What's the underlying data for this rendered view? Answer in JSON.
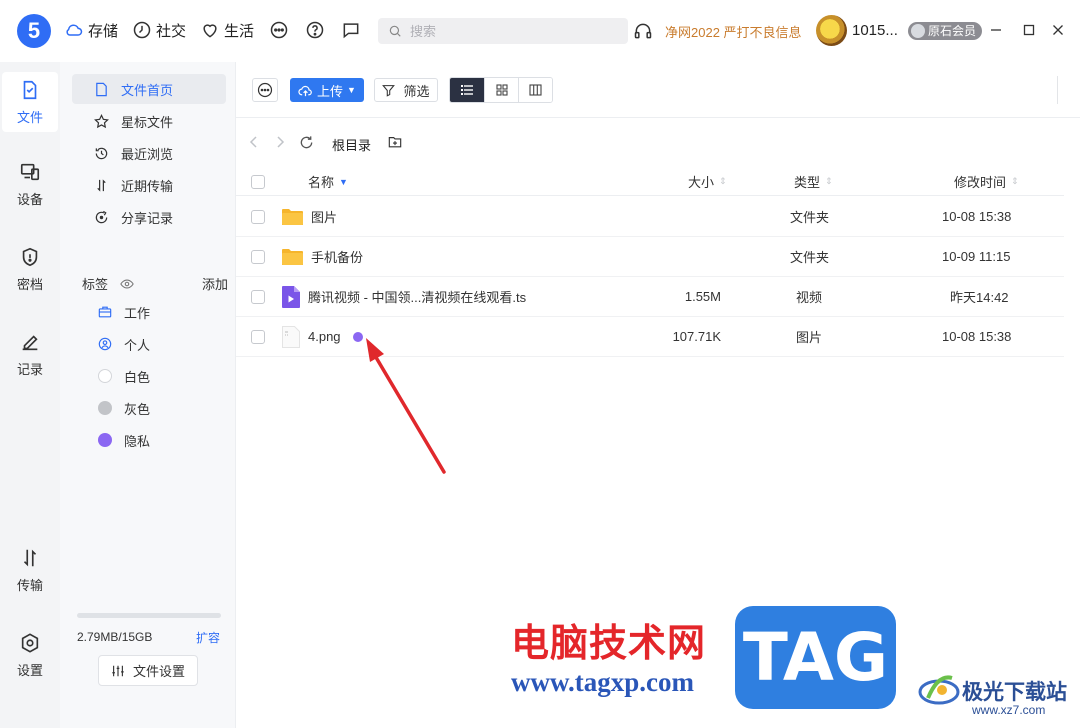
{
  "app": {
    "logo_text": "5",
    "nav": [
      {
        "label": "存储",
        "icon": "cloud-icon"
      },
      {
        "label": "社交",
        "icon": "clock-icon"
      },
      {
        "label": "生活",
        "icon": "heart-icon"
      }
    ],
    "search_placeholder": "搜索",
    "promo_text": "净网2022 严打不良信息",
    "username": "1015...",
    "vip_label": "原石会员"
  },
  "rail": [
    {
      "label": "文件",
      "icon": "file-icon",
      "active": true
    },
    {
      "label": "设备",
      "icon": "device-icon"
    },
    {
      "label": "密档",
      "icon": "shield-icon"
    },
    {
      "label": "记录",
      "icon": "pen-icon"
    },
    {
      "label": "传输",
      "icon": "transfer-icon"
    },
    {
      "label": "设置",
      "icon": "settings-icon"
    }
  ],
  "sidebar": {
    "items": [
      {
        "label": "文件首页",
        "icon": "file-home-icon",
        "active": true
      },
      {
        "label": "星标文件",
        "icon": "star-icon"
      },
      {
        "label": "最近浏览",
        "icon": "history-icon"
      },
      {
        "label": "近期传输",
        "icon": "transfer-icon"
      },
      {
        "label": "分享记录",
        "icon": "share-icon"
      }
    ],
    "tags_title": "标签",
    "tags_add": "添加",
    "tags": [
      {
        "label": "工作",
        "icon": "briefcase-icon"
      },
      {
        "label": "个人",
        "icon": "person-icon"
      },
      {
        "label": "白色",
        "color": "#ffffff"
      },
      {
        "label": "灰色",
        "color": "#c2c4c8"
      },
      {
        "label": "隐私",
        "color": "#8b67f2"
      }
    ],
    "storage_used": "2.79MB/15GB",
    "storage_fraction": 0.0002,
    "expand_label": "扩容",
    "settings_label": "文件设置"
  },
  "toolbar": {
    "upload_label": "上传",
    "filter_label": "筛选"
  },
  "path": {
    "root_label": "根目录"
  },
  "table": {
    "columns": [
      "名称",
      "大小",
      "类型",
      "修改时间"
    ],
    "rows": [
      {
        "name": "图片",
        "size": "",
        "type": "文件夹",
        "modified": "10-08 15:38",
        "icon": "folder-icon"
      },
      {
        "name": "手机备份",
        "size": "",
        "type": "文件夹",
        "modified": "10-09 11:15",
        "icon": "folder-icon"
      },
      {
        "name": "腾讯视频 - 中国领...清视频在线观看.ts",
        "size": "1.55M",
        "type": "视频",
        "modified": "昨天14:42",
        "icon": "video-file-icon"
      },
      {
        "name": "4.png",
        "size": "107.71K",
        "type": "图片",
        "modified": "10-08 15:38",
        "icon": "image-file-icon",
        "tag_color": "#8b67f2"
      }
    ]
  },
  "watermark": {
    "title": "电脑技术网",
    "url": "www.tagxp.com",
    "badge": "TAG",
    "site_name": "极光下载站",
    "site_url": "www.xz7.com"
  },
  "colors": {
    "accent": "#2f6df5",
    "private_tag": "#8b67f2",
    "promo": "#c97c2e"
  }
}
